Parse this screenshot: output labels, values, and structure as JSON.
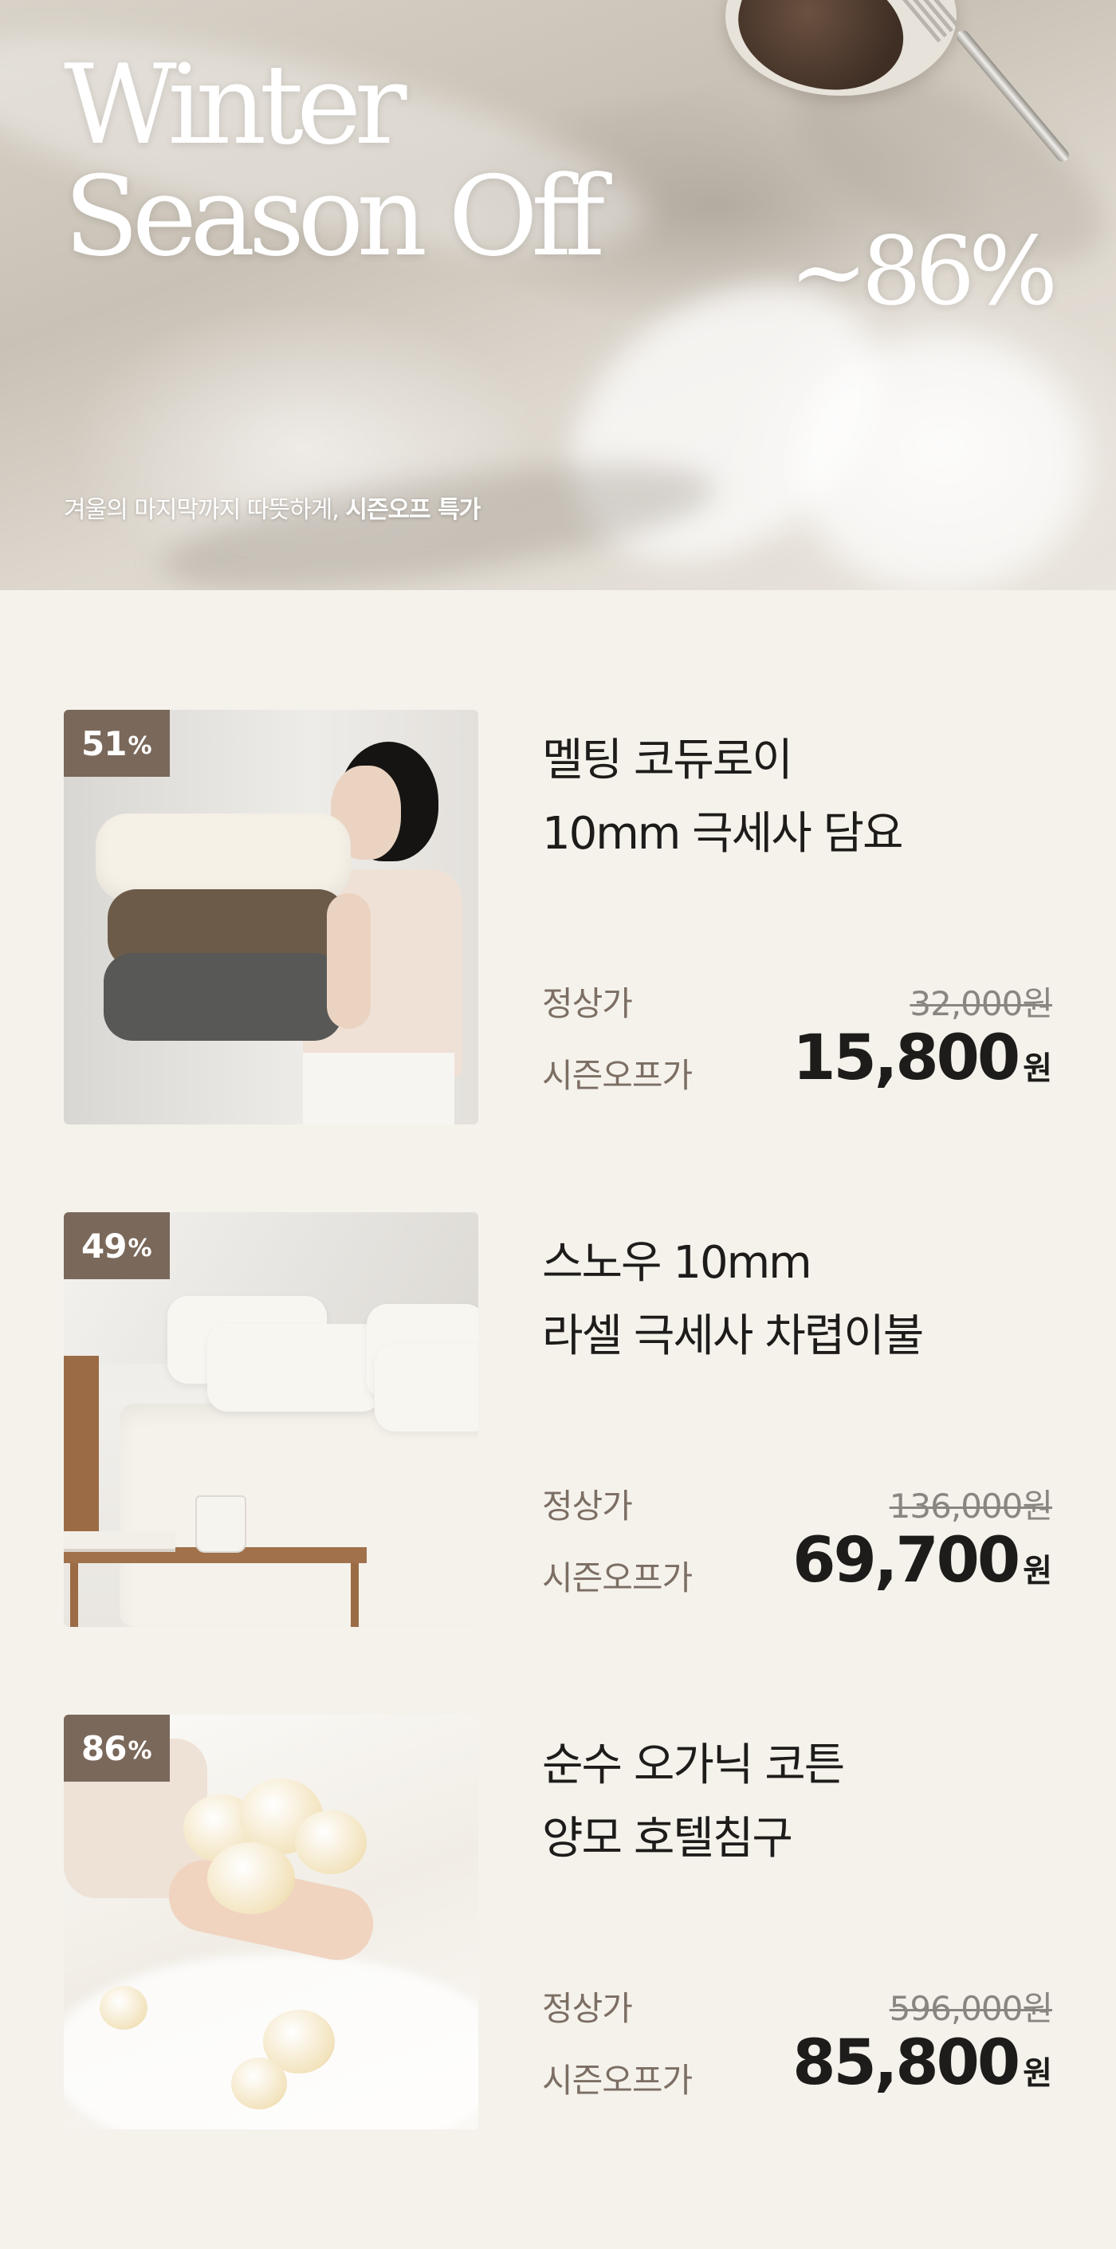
{
  "hero": {
    "title_line1": "Winter",
    "title_line2": "Season Off",
    "discount": "~86%",
    "subtitle_regular": "겨울의 마지막까지 따뜻하게, ",
    "subtitle_bold": "시즌오프 특가"
  },
  "labels": {
    "regular": "정상가",
    "sale": "시즌오프가",
    "currency": "원"
  },
  "products": [
    {
      "badge_number": "51",
      "badge_unit": "%",
      "name_line1": "멜팅 코듀로이",
      "name_line2": "10mm 극세사 담요",
      "regular_price": "32,000원",
      "sale_price": "15,800"
    },
    {
      "badge_number": "49",
      "badge_unit": "%",
      "name_line1": "스노우 10mm",
      "name_line2": "라셀 극세사 차렵이불",
      "regular_price": "136,000원",
      "sale_price": "69,700"
    },
    {
      "badge_number": "86",
      "badge_unit": "%",
      "name_line1": "순수 오가닉 코튼",
      "name_line2": "양모 호텔침구",
      "regular_price": "596,000원",
      "sale_price": "85,800"
    }
  ],
  "colors": {
    "background": "#f5f2ec",
    "badge": "#7a685a",
    "label_text": "#7c6e63",
    "strikethrough_text": "#8a8580",
    "primary_text": "#1e1c1a"
  }
}
